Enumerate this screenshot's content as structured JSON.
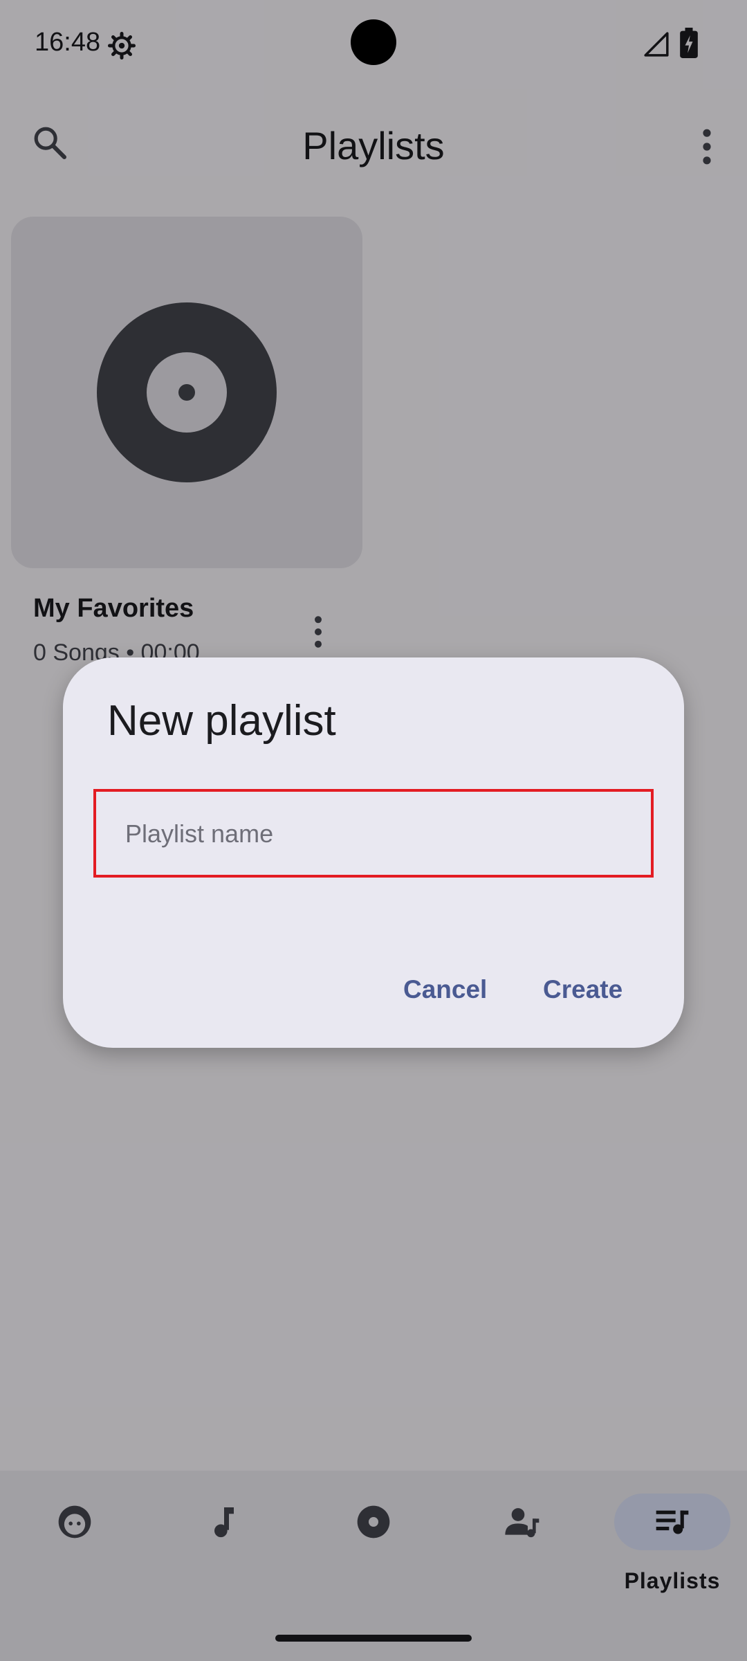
{
  "status_bar": {
    "time": "16:48",
    "icons": [
      "settings-gear-icon",
      "signal-icon",
      "battery-charging-icon"
    ]
  },
  "app_bar": {
    "title": "Playlists",
    "search_icon": "search-icon",
    "menu_icon": "more-vert-icon"
  },
  "playlists": [
    {
      "name": "My Favorites",
      "meta": "0 Songs  •  00:00",
      "artwork_icon": "disc-icon"
    }
  ],
  "dialog": {
    "title": "New playlist",
    "input_placeholder": "Playlist name",
    "input_value": "",
    "cancel_label": "Cancel",
    "create_label": "Create"
  },
  "bottom_nav": {
    "items": [
      {
        "icon": "face-icon",
        "label": ""
      },
      {
        "icon": "music-note-icon",
        "label": ""
      },
      {
        "icon": "album-icon",
        "label": ""
      },
      {
        "icon": "artist-icon",
        "label": ""
      },
      {
        "icon": "playlist-icon",
        "label": "Playlists",
        "active": true
      }
    ]
  },
  "colors": {
    "accent": "#4a5a92",
    "highlight_border": "#e31c23",
    "active_nav_pill": "#dce2f9"
  }
}
